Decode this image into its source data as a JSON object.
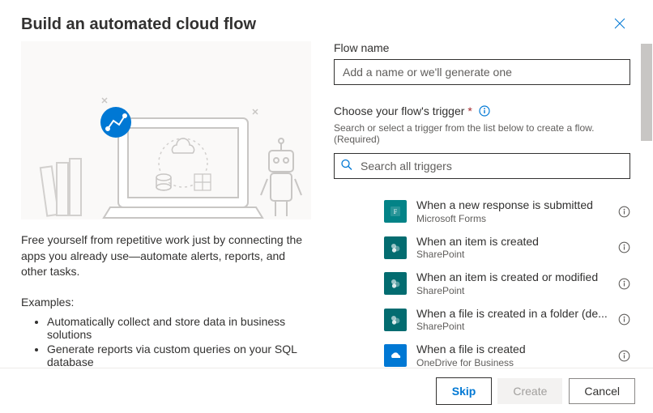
{
  "header": {
    "title": "Build an automated cloud flow"
  },
  "left": {
    "description": "Free yourself from repetitive work just by connecting the apps you already use—automate alerts, reports, and other tasks.",
    "examples_heading": "Examples:",
    "examples": [
      "Automatically collect and store data in business solutions",
      "Generate reports via custom queries on your SQL database"
    ]
  },
  "right": {
    "flow_name_label": "Flow name",
    "flow_name_placeholder": "Add a name or we'll generate one",
    "flow_name_value": "",
    "trigger_label": "Choose your flow's trigger",
    "trigger_hint": "Search or select a trigger from the list below to create a flow. (Required)",
    "search_placeholder": "Search all triggers",
    "search_value": "",
    "triggers": [
      {
        "title": "When a new response is submitted",
        "subtitle": "Microsoft Forms",
        "color": "#038387",
        "icon": "forms"
      },
      {
        "title": "When an item is created",
        "subtitle": "SharePoint",
        "color": "#036c70",
        "icon": "sharepoint"
      },
      {
        "title": "When an item is created or modified",
        "subtitle": "SharePoint",
        "color": "#036c70",
        "icon": "sharepoint"
      },
      {
        "title": "When a file is created in a folder (de...",
        "subtitle": "SharePoint",
        "color": "#036c70",
        "icon": "sharepoint"
      },
      {
        "title": "When a file is created",
        "subtitle": "OneDrive for Business",
        "color": "#0078d4",
        "icon": "onedrive"
      }
    ]
  },
  "footer": {
    "skip": "Skip",
    "create": "Create",
    "cancel": "Cancel"
  },
  "colors": {
    "primary": "#0078d4",
    "text": "#323130",
    "muted": "#605e5c"
  }
}
